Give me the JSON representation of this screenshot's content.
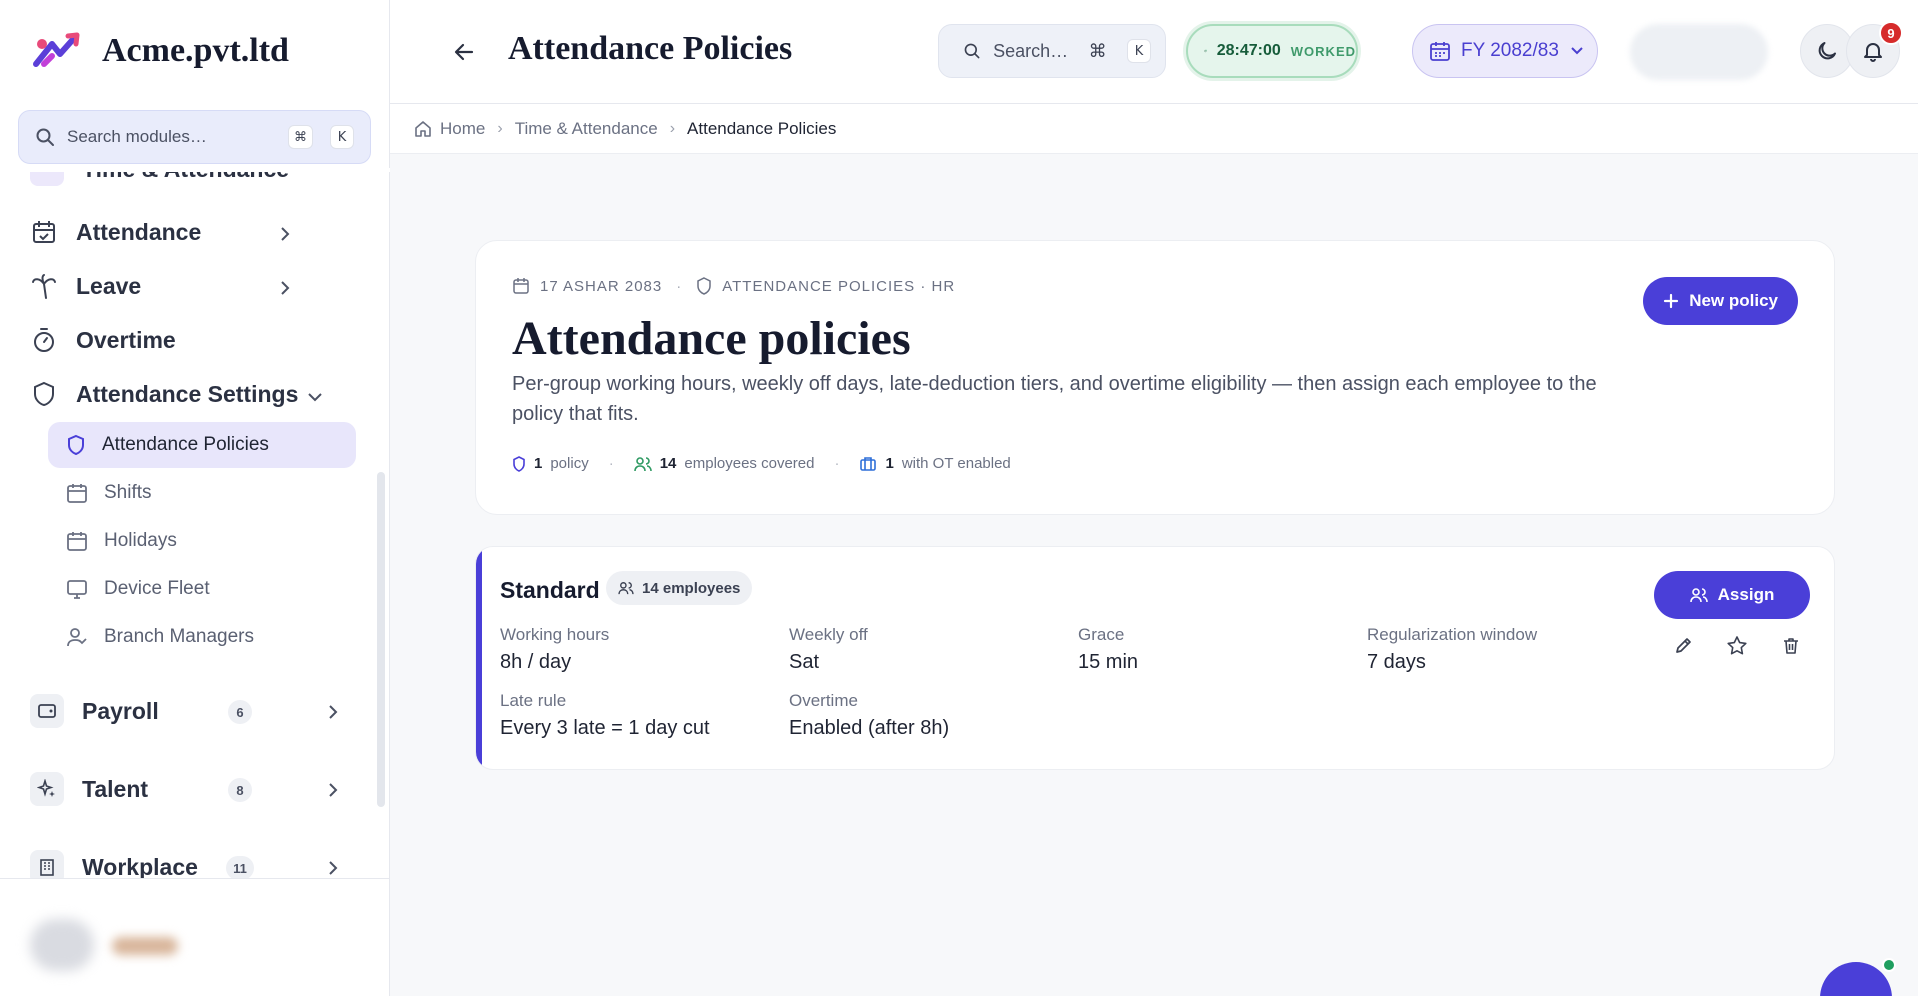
{
  "brand": {
    "name": "Acme.pvt.ltd"
  },
  "sidebar": {
    "search_placeholder": "Search modules…",
    "search_kbd": [
      "⌘",
      "K"
    ],
    "cut_item": "Time & Attendance",
    "items": [
      {
        "label": "Attendance",
        "icon": "calendar-check-icon"
      },
      {
        "label": "Leave",
        "icon": "palm-tree-icon"
      },
      {
        "label": "Overtime",
        "icon": "stopwatch-icon"
      },
      {
        "label": "Attendance Settings",
        "icon": "shield-icon"
      }
    ],
    "sub_items": [
      {
        "label": "Attendance Policies",
        "icon": "shield-icon",
        "active": true
      },
      {
        "label": "Shifts",
        "icon": "calendar-icon"
      },
      {
        "label": "Holidays",
        "icon": "calendar-icon"
      },
      {
        "label": "Device Fleet",
        "icon": "monitor-icon"
      },
      {
        "label": "Branch Managers",
        "icon": "user-check-icon"
      }
    ],
    "groups": [
      {
        "label": "Payroll",
        "count": "6",
        "icon": "wallet-icon"
      },
      {
        "label": "Talent",
        "count": "8",
        "icon": "sparkles-icon"
      },
      {
        "label": "Workplace",
        "count": "11",
        "icon": "building-icon"
      }
    ]
  },
  "topbar": {
    "title": "Attendance Policies",
    "search_placeholder": "Search…",
    "search_kbd": [
      "⌘",
      "K"
    ],
    "worked_time": "28:47:00",
    "worked_label": "WORKED",
    "fiscal_year": "FY 2082/83",
    "notification_count": "9"
  },
  "breadcrumb": [
    "Home",
    "Time & Attendance",
    "Attendance Policies"
  ],
  "header": {
    "date": "17 ASHAR 2083",
    "section": "ATTENDANCE POLICIES · HR",
    "title": "Attendance policies",
    "description": "Per-group working hours, weekly off days, late-deduction tiers, and overtime eligibility — then assign each employee to the policy that fits.",
    "stats": [
      {
        "value": "1",
        "label": "policy"
      },
      {
        "value": "14",
        "label": "employees covered"
      },
      {
        "value": "1",
        "label": "with OT enabled"
      }
    ],
    "new_button": "New policy"
  },
  "policy": {
    "name": "Standard",
    "employees": "14 employees",
    "assign_button": "Assign",
    "fields": [
      {
        "label": "Working hours",
        "value": "8h / day"
      },
      {
        "label": "Weekly off",
        "value": "Sat"
      },
      {
        "label": "Grace",
        "value": "15 min"
      },
      {
        "label": "Regularization window",
        "value": "7 days"
      },
      {
        "label": "Late rule",
        "value": "Every 3 late = 1 day cut"
      },
      {
        "label": "Overtime",
        "value": "Enabled (after 8h)"
      }
    ]
  },
  "colors": {
    "accent": "#4a3fd8",
    "worked_bg": "#e5f5ec",
    "notif_red": "#d62b2b"
  }
}
